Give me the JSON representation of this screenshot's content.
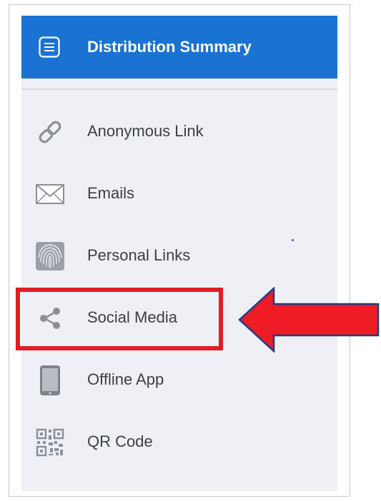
{
  "header": {
    "title": "Distribution Summary",
    "icon": "menu-list-icon"
  },
  "nav": {
    "items": [
      {
        "label": "Anonymous Link",
        "icon": "link-icon"
      },
      {
        "label": "Emails",
        "icon": "envelope-icon"
      },
      {
        "label": "Personal Links",
        "icon": "fingerprint-icon"
      },
      {
        "label": "Social Media",
        "icon": "share-icon",
        "highlighted": true
      },
      {
        "label": "Offline App",
        "icon": "tablet-icon"
      },
      {
        "label": "QR Code",
        "icon": "qr-code-icon"
      }
    ]
  },
  "colors": {
    "header_bg": "#1a73d2",
    "panel_bg": "#eef0f5",
    "highlight": "#e31b23",
    "arrow_outline": "#1c3d8f"
  }
}
